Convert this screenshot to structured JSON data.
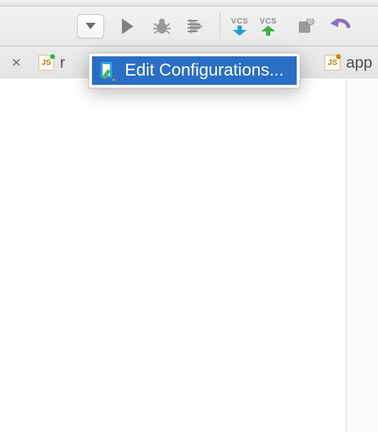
{
  "toolbar": {
    "vcs_label": "VCS"
  },
  "tabs": {
    "close": "×",
    "left_file_prefix": "r",
    "right_file_prefix": "app"
  },
  "popup": {
    "edit_configurations": "Edit Configurations..."
  }
}
